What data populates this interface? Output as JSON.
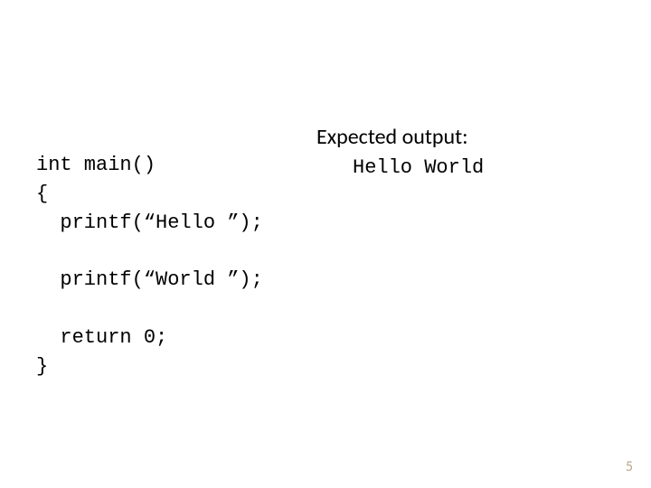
{
  "code": {
    "line1": "int main()",
    "line2": "{",
    "line3": "  printf(“Hello ”);",
    "line4": "",
    "line5": "  printf(“World ”);",
    "line6": "",
    "line7": "  return 0;",
    "line8": "}"
  },
  "expected": {
    "heading": "Expected output:",
    "output": "Hello World"
  },
  "page_number": "5"
}
